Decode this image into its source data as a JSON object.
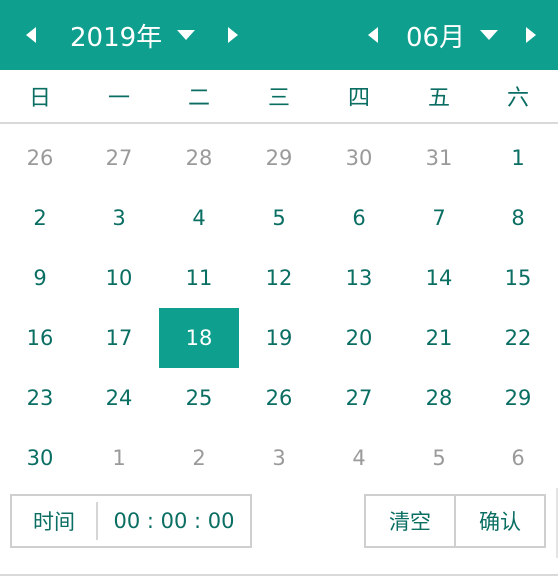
{
  "header": {
    "year_label": "2019年",
    "month_label": "06月",
    "prev_year_icon": "caret-left-icon",
    "next_year_icon": "caret-right-icon",
    "prev_month_icon": "caret-left-icon",
    "next_month_icon": "caret-right-icon",
    "dropdown_icon": "caret-down-icon",
    "background_color": "#0e9f8e"
  },
  "weekdays": [
    "日",
    "一",
    "二",
    "三",
    "四",
    "五",
    "六"
  ],
  "calendar": {
    "selected": "18",
    "weeks": [
      [
        {
          "d": "26",
          "other": true
        },
        {
          "d": "27",
          "other": true
        },
        {
          "d": "28",
          "other": true
        },
        {
          "d": "29",
          "other": true
        },
        {
          "d": "30",
          "other": true
        },
        {
          "d": "31",
          "other": true
        },
        {
          "d": "1",
          "other": false
        }
      ],
      [
        {
          "d": "2",
          "other": false
        },
        {
          "d": "3",
          "other": false
        },
        {
          "d": "4",
          "other": false
        },
        {
          "d": "5",
          "other": false
        },
        {
          "d": "6",
          "other": false
        },
        {
          "d": "7",
          "other": false
        },
        {
          "d": "8",
          "other": false
        }
      ],
      [
        {
          "d": "9",
          "other": false
        },
        {
          "d": "10",
          "other": false
        },
        {
          "d": "11",
          "other": false
        },
        {
          "d": "12",
          "other": false
        },
        {
          "d": "13",
          "other": false
        },
        {
          "d": "14",
          "other": false
        },
        {
          "d": "15",
          "other": false
        }
      ],
      [
        {
          "d": "16",
          "other": false
        },
        {
          "d": "17",
          "other": false
        },
        {
          "d": "18",
          "other": false,
          "selected": true
        },
        {
          "d": "19",
          "other": false
        },
        {
          "d": "20",
          "other": false
        },
        {
          "d": "21",
          "other": false
        },
        {
          "d": "22",
          "other": false
        }
      ],
      [
        {
          "d": "23",
          "other": false
        },
        {
          "d": "24",
          "other": false
        },
        {
          "d": "25",
          "other": false
        },
        {
          "d": "26",
          "other": false
        },
        {
          "d": "27",
          "other": false
        },
        {
          "d": "28",
          "other": false
        },
        {
          "d": "29",
          "other": false
        }
      ],
      [
        {
          "d": "30",
          "other": false
        },
        {
          "d": "1",
          "other": true
        },
        {
          "d": "2",
          "other": true
        },
        {
          "d": "3",
          "other": true
        },
        {
          "d": "4",
          "other": true
        },
        {
          "d": "5",
          "other": true
        },
        {
          "d": "6",
          "other": true
        }
      ]
    ]
  },
  "footer": {
    "time_label": "时间",
    "time_value": "00 : 00 : 00",
    "clear_label": "清空",
    "confirm_label": "确认"
  },
  "colors": {
    "accent": "#0e9f8e",
    "text": "#0a6e63",
    "muted": "#9a9a9a"
  }
}
